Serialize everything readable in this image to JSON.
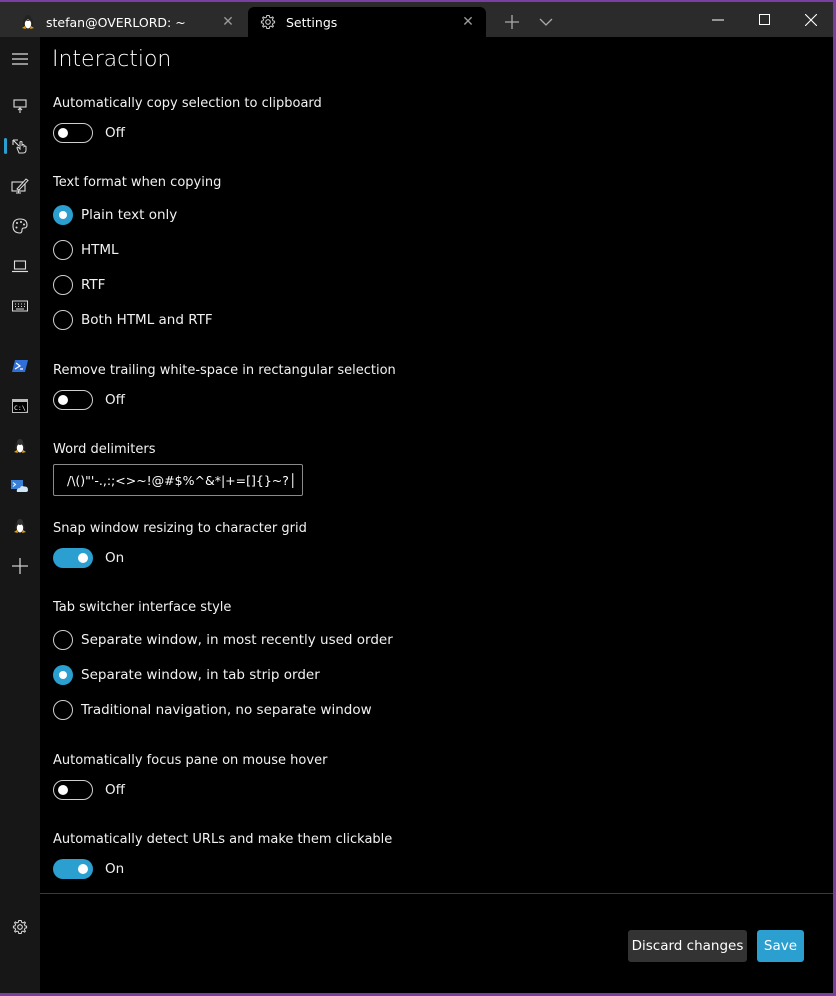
{
  "titlebar": {
    "tabs": [
      {
        "label": "stefan@OVERLORD: ~",
        "icon": "linux-tux-icon",
        "active": false
      },
      {
        "label": "Settings",
        "icon": "gear-icon",
        "active": true
      }
    ],
    "new_tab_symbol": "+",
    "close_symbol": "✕"
  },
  "sidebar": {
    "items": [
      {
        "name": "menu",
        "icon": "hamburger-icon"
      },
      {
        "name": "startup",
        "icon": "startup-icon"
      },
      {
        "name": "interaction",
        "icon": "interaction-hand-icon",
        "selected": true
      },
      {
        "name": "appearance",
        "icon": "appearance-icon"
      },
      {
        "name": "color-schemes",
        "icon": "palette-icon"
      },
      {
        "name": "rendering",
        "icon": "laptop-icon"
      },
      {
        "name": "actions",
        "icon": "keyboard-icon"
      },
      {
        "name": "powershell-profile",
        "icon": "powershell-icon"
      },
      {
        "name": "cmd-profile",
        "icon": "cmd-icon"
      },
      {
        "name": "linux-profile-1",
        "icon": "linux-tux-icon"
      },
      {
        "name": "azure-shell-profile",
        "icon": "azure-cloud-shell-icon"
      },
      {
        "name": "linux-profile-2",
        "icon": "linux-tux-icon"
      },
      {
        "name": "add-profile",
        "icon": "plus-icon"
      }
    ],
    "settings_icon": "gear-icon"
  },
  "page": {
    "title": "Interaction",
    "copy_on_select": {
      "label": "Automatically copy selection to clipboard",
      "value": false,
      "state_text": "Off"
    },
    "copy_format": {
      "label": "Text format when copying",
      "options": [
        "Plain text only",
        "HTML",
        "RTF",
        "Both HTML and RTF"
      ],
      "selected": "Plain text only"
    },
    "trim_block_selection": {
      "label": "Remove trailing white-space in rectangular selection",
      "value": false,
      "state_text": "Off"
    },
    "word_delimiters": {
      "label": "Word delimiters",
      "value": "/\\()\"'-.,:;<>~!@#$%^&*|+=[]{}~?│"
    },
    "snap_on_resize": {
      "label": "Snap window resizing to character grid",
      "value": true,
      "state_text": "On"
    },
    "tab_switcher": {
      "label": "Tab switcher interface style",
      "options": [
        "Separate window, in most recently used order",
        "Separate window, in tab strip order",
        "Traditional navigation, no separate window"
      ],
      "selected": "Separate window, in tab strip order"
    },
    "focus_follow_mouse": {
      "label": "Automatically focus pane on mouse hover",
      "value": false,
      "state_text": "Off"
    },
    "detect_urls": {
      "label": "Automatically detect URLs and make them clickable",
      "value": true,
      "state_text": "On"
    }
  },
  "footer": {
    "discard_label": "Discard changes",
    "save_label": "Save"
  },
  "colors": {
    "accent": "#2a9fd0",
    "window_border": "#7a3fa0",
    "sidebar_bg": "#171717",
    "titlebar_bg": "#2b2b2b"
  }
}
